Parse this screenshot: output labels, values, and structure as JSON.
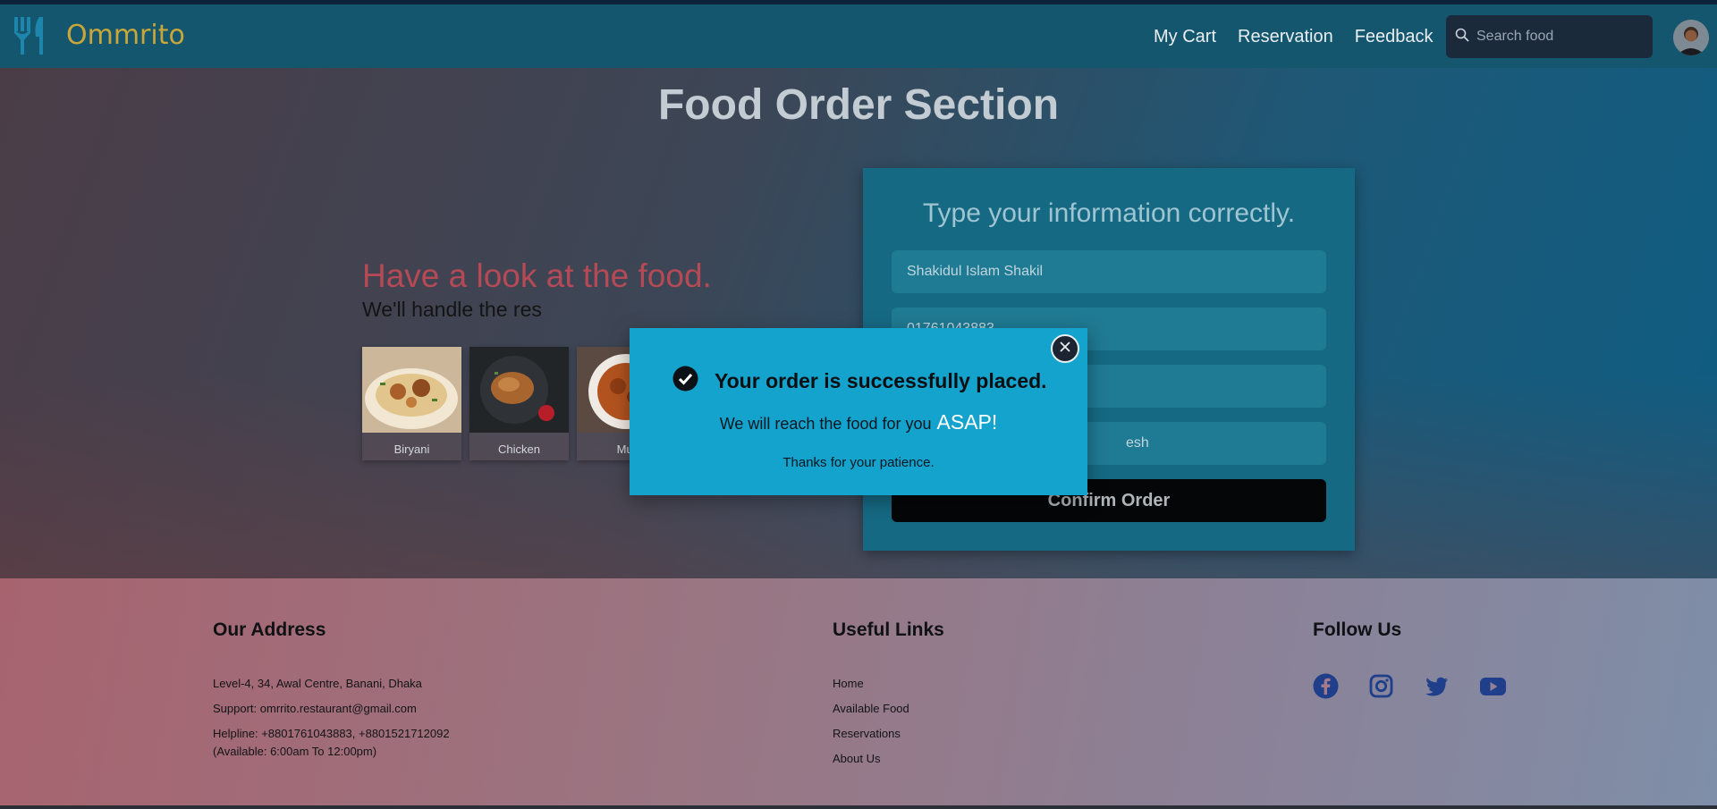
{
  "header": {
    "brand_name": "Ommrito",
    "nav": [
      "My Cart",
      "Reservation",
      "Feedback"
    ],
    "search_placeholder": "Search food"
  },
  "main": {
    "title": "Food Order Section",
    "lead_title": "Have a look at the food.",
    "lead_subtitle": "We'll handle the res",
    "foods": [
      "Biryani",
      "Chicken",
      "Mut"
    ],
    "form": {
      "title": "Type your information correctly.",
      "name_value": "Shakidul Islam Shakil",
      "phone_value": "01761043883",
      "address_value": "",
      "country_value": "esh",
      "confirm_label": "Confirm Order"
    }
  },
  "modal": {
    "title": "Your order is successfully placed.",
    "line": "We will reach the food for you",
    "asap": "ASAP!",
    "thanks": "Thanks for your patience."
  },
  "footer": {
    "address": {
      "heading": "Our Address",
      "line1": "Level-4, 34, Awal Centre, Banani, Dhaka",
      "line2": "Support: omrrito.restaurant@gmail.com",
      "line3": "Helpline: +8801761043883, +8801521712092",
      "line4": "(Available: 6:00am To 12:00pm)"
    },
    "links": {
      "heading": "Useful Links",
      "items": [
        "Home",
        "Available Food",
        "Reservations",
        "About Us"
      ]
    },
    "follow": {
      "heading": "Follow Us",
      "icons": [
        "facebook-icon",
        "instagram-icon",
        "twitter-icon",
        "youtube-icon"
      ]
    }
  },
  "colors": {
    "navbar": "#15566f",
    "brand": "#c9a63a",
    "modal": "#14a3cd",
    "social": "#1f3f8a"
  }
}
